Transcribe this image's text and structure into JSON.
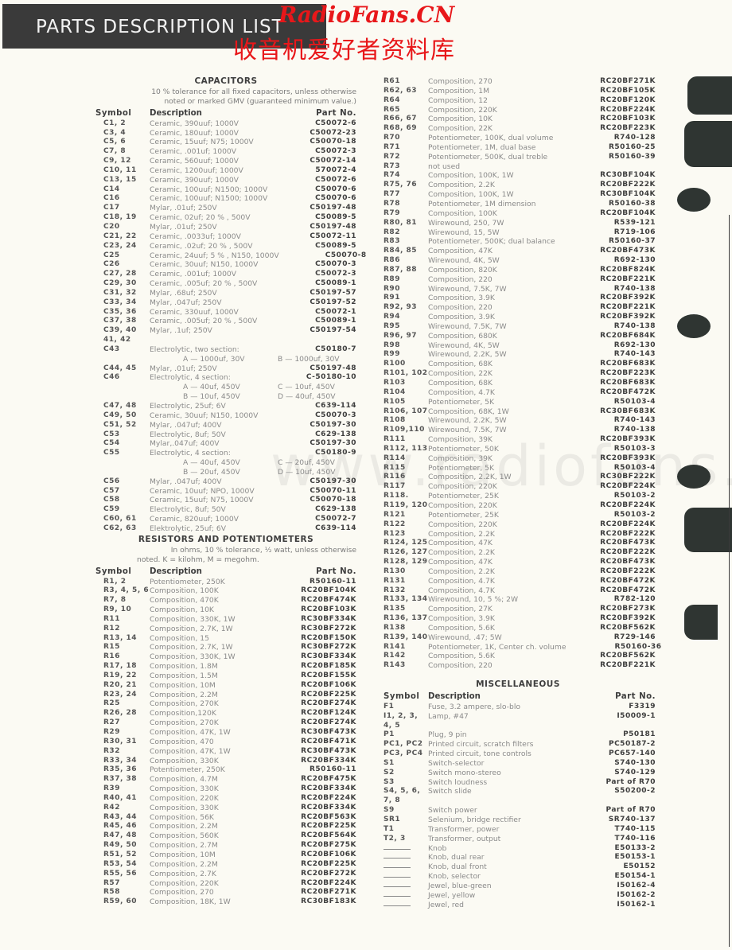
{
  "header": {
    "title": "PARTS DESCRIPTION LIST",
    "watermark_en": "RadioFans.CN",
    "watermark_cn": "收音机爱好者资料库",
    "watermark_faint": "www.radiofans.cn"
  },
  "columns": {
    "symbol": "Symbol",
    "description": "Description",
    "part_no": "Part No."
  },
  "capacitors": {
    "title": "CAPACITORS",
    "note_line1": "10 % tolerance for all fixed capacitors, unless otherwise",
    "note_line2": "noted or marked GMV (guaranteed minimum value.)",
    "rows": [
      {
        "sym": "C1, 2",
        "desc": "Ceramic, 390uuf; 1000V",
        "part": "C50072-6"
      },
      {
        "sym": "C3, 4",
        "desc": "Ceramic, 180uuf; 1000V",
        "part": "C50072-23"
      },
      {
        "sym": "C5, 6",
        "desc": "Ceramic, 15uuf; N75; 1000V",
        "part": "C50070-18"
      },
      {
        "sym": "C7, 8",
        "desc": "Ceramic, .001uf; 1000V",
        "part": "C50072-3"
      },
      {
        "sym": "C9, 12",
        "desc": "Ceramic, 560uuf; 1000V",
        "part": "C50072-14"
      },
      {
        "sym": "C10, 11",
        "desc": "Ceramic, 1200uuf; 1000V",
        "part": "570072-4"
      },
      {
        "sym": "C13, 15",
        "desc": "Ceramic, 390uuf; 1000V",
        "part": "C50072-6"
      },
      {
        "sym": "C14",
        "desc": "Ceramic, 100uuf; N1500; 1000V",
        "part": "C50070-6"
      },
      {
        "sym": "C16",
        "desc": "Ceramic, 100uuf; N1500; 1000V",
        "part": "C50070-6"
      },
      {
        "sym": "C17",
        "desc": "Mylar, .01uf; 250V",
        "part": "C50197-48"
      },
      {
        "sym": "C18, 19",
        "desc": "Ceramic, 02uf; 20 % , 500V",
        "part": "C50089-5"
      },
      {
        "sym": "C20",
        "desc": "Mylar, .01uf; 250V",
        "part": "C50197-48"
      },
      {
        "sym": "C21, 22",
        "desc": "Ceramic, .0033uf; 1000V",
        "part": "C50072-11"
      },
      {
        "sym": "C23, 24",
        "desc": "Ceramic, .02uf; 20 % , 500V",
        "part": "C50089-5"
      },
      {
        "sym": "C25",
        "desc": "Ceramic, 24uuf; 5 % , N150, 1000V",
        "part": "C50070-8"
      },
      {
        "sym": "C26",
        "desc": "Ceramic, 30uuf; N150, 1000V",
        "part": "C50070-3"
      },
      {
        "sym": "C27, 28",
        "desc": "Ceramic, .001uf; 1000V",
        "part": "C50072-3"
      },
      {
        "sym": "C29, 30",
        "desc": "Ceramic, .005uf; 20 % , 500V",
        "part": "C50089-1"
      },
      {
        "sym": "C31, 32",
        "desc": "Mylar, .68uf; 250V",
        "part": "C50197-57"
      },
      {
        "sym": "C33, 34",
        "desc": "Mylar, .047uf; 250V",
        "part": "C50197-52"
      },
      {
        "sym": "C35, 36",
        "desc": "Ceramic, 330uuf, 1000V",
        "part": "C50072-1"
      },
      {
        "sym": "C37, 38",
        "desc": "Ceramic, .005uf; 20 % , 500V",
        "part": "C50089-1"
      },
      {
        "sym": "C39, 40",
        "desc": "Mylar, .1uf; 250V",
        "part": "C50197-54"
      },
      {
        "sym": "41, 42",
        "desc": "",
        "part": ""
      },
      {
        "sym": "C43",
        "desc": "Electrolytic, two section:",
        "part": "C50180-7",
        "sub": [
          [
            "A — 1000uf, 30V",
            "B — 1000uf, 30V"
          ]
        ]
      },
      {
        "sym": "C44, 45",
        "desc": "Mylar, .01uf; 250V",
        "part": "C50197-48"
      },
      {
        "sym": "C46",
        "desc": "Electrolytic, 4 section:",
        "part": "C-50180-10",
        "sub": [
          [
            "A — 40uf, 450V",
            "C — 10uf, 450V"
          ],
          [
            "B — 10uf, 450V",
            "D — 40uf, 450V"
          ]
        ]
      },
      {
        "sym": "C47, 48",
        "desc": "Electrolytic, 25uf; 6V",
        "part": "C639-114"
      },
      {
        "sym": "C49, 50",
        "desc": "Ceramic, 30uuf; N150, 1000V",
        "part": "C50070-3"
      },
      {
        "sym": "C51, 52",
        "desc": "Mylar, .047uf; 400V",
        "part": "C50197-30"
      },
      {
        "sym": "C53",
        "desc": "Electrolytic, 8uf; 50V",
        "part": "C629-138"
      },
      {
        "sym": "C54",
        "desc": "Mylar,.047uf; 400V",
        "part": "C50197-30"
      },
      {
        "sym": "C55",
        "desc": "Electrolytic, 4 section:",
        "part": "C50180-9",
        "sub": [
          [
            "A — 40uf, 450V",
            "C — 20uf, 450V"
          ],
          [
            "B — 20uf, 450V",
            "D — 10uf, 450V"
          ]
        ]
      },
      {
        "sym": "C56",
        "desc": "Mylar, .047uf; 400V",
        "part": "C50197-30"
      },
      {
        "sym": "C57",
        "desc": "Ceramic, 10uuf; NPO, 1000V",
        "part": "C50070-11"
      },
      {
        "sym": "C58",
        "desc": "Ceramic, 15uuf; N75, 1000V",
        "part": "C50070-18"
      },
      {
        "sym": "C59",
        "desc": "Electrolytic, 8uf; 50V",
        "part": "C629-138"
      },
      {
        "sym": "C60, 61",
        "desc": "Ceramic, 820uuf; 1000V",
        "part": "C50072-7"
      },
      {
        "sym": "C62, 63",
        "desc": "Elektrolytic, 25uf; 6V",
        "part": "C639-114"
      }
    ]
  },
  "resistors": {
    "title": "RESISTORS AND POTENTIOMETERS",
    "note_line1": "In ohms, 10 % tolerance, ½ watt, unless otherwise",
    "note_line2": "noted. K = kilohm, M = megohm.",
    "rows_left": [
      {
        "sym": "R1, 2",
        "desc": "Potentiometer, 250K",
        "part": "R50160-11"
      },
      {
        "sym": "R3, 4, 5, 6",
        "desc": "Composition, 100K",
        "part": "RC20BF104K"
      },
      {
        "sym": "R7, 8",
        "desc": "Composition, 470K",
        "part": "RC20BF474K"
      },
      {
        "sym": "R9, 10",
        "desc": "Composition, 10K",
        "part": "RC20BF103K"
      },
      {
        "sym": "R11",
        "desc": "Composition, 330K, 1W",
        "part": "RC30BF334K"
      },
      {
        "sym": "R12",
        "desc": "Composition, 2.7K, 1W",
        "part": "RC30BF272K"
      },
      {
        "sym": "R13, 14",
        "desc": "Composition, 15",
        "part": "RC20BF150K"
      },
      {
        "sym": "R15",
        "desc": "Composition, 2.7K, 1W",
        "part": "RC30BF272K"
      },
      {
        "sym": "R16",
        "desc": "Composition, 330K, 1W",
        "part": "RC30BF334K"
      },
      {
        "sym": "R17, 18",
        "desc": "Composition, 1.8M",
        "part": "RC20BF185K"
      },
      {
        "sym": "R19, 22",
        "desc": "Composition, 1.5M",
        "part": "RC20BF155K"
      },
      {
        "sym": "R20, 21",
        "desc": "Composition, 10M",
        "part": "RC20BF106K"
      },
      {
        "sym": "R23, 24",
        "desc": "Composition, 2.2M",
        "part": "RC20BF225K"
      },
      {
        "sym": "R25",
        "desc": "Composition, 270K",
        "part": "RC20BF274K"
      },
      {
        "sym": "R26, 28",
        "desc": "Composition,120K",
        "part": "RC20BF124K"
      },
      {
        "sym": "R27",
        "desc": "Composition, 270K",
        "part": "RC20BF274K"
      },
      {
        "sym": "R29",
        "desc": "Composition, 47K, 1W",
        "part": "RC30BF473K"
      },
      {
        "sym": "R30, 31",
        "desc": "Composition, 470",
        "part": "RC20BF471K"
      },
      {
        "sym": "R32",
        "desc": "Composition, 47K, 1W",
        "part": "RC30BF473K"
      },
      {
        "sym": "R33, 34",
        "desc": "Composition, 330K",
        "part": "RC20BF334K"
      },
      {
        "sym": "R35, 36",
        "desc": "Potentiometer, 250K",
        "part": "R50160-11"
      },
      {
        "sym": "R37, 38",
        "desc": "Composition, 4.7M",
        "part": "RC20BF475K"
      },
      {
        "sym": "R39",
        "desc": "Composition, 330K",
        "part": "RC20BF334K"
      },
      {
        "sym": "R40, 41",
        "desc": "Composition, 220K",
        "part": "RC20BF224K"
      },
      {
        "sym": "R42",
        "desc": "Composition, 330K",
        "part": "RC20BF334K"
      },
      {
        "sym": "R43, 44",
        "desc": "Composition, 56K",
        "part": "RC20BF563K"
      },
      {
        "sym": "R45, 46",
        "desc": "Composition, 2.2M",
        "part": "RC20BF225K"
      },
      {
        "sym": "R47, 48",
        "desc": "Composition, 560K",
        "part": "RC20BF564K"
      },
      {
        "sym": "R49, 50",
        "desc": "Composition, 2.7M",
        "part": "RC20BF275K"
      },
      {
        "sym": "R51, 52",
        "desc": "Composition, 10M",
        "part": "RC20BF106K"
      },
      {
        "sym": "R53, 54",
        "desc": "Composition, 2.2M",
        "part": "RC20BF225K"
      },
      {
        "sym": "R55, 56",
        "desc": "Composition, 2.7K",
        "part": "RC20BF272K"
      },
      {
        "sym": "R57",
        "desc": "Composition, 220K",
        "part": "RC20BF224K"
      },
      {
        "sym": "R58",
        "desc": "Composition, 270",
        "part": "RC20BF271K"
      },
      {
        "sym": "R59, 60",
        "desc": "Composition, 18K, 1W",
        "part": "RC30BF183K"
      }
    ],
    "rows_right": [
      {
        "sym": "R61",
        "desc": "Composition, 270",
        "part": "RC20BF271K"
      },
      {
        "sym": "R62, 63",
        "desc": "Composition, 1M",
        "part": "RC20BF105K"
      },
      {
        "sym": "R64",
        "desc": "Composition, 12",
        "part": "RC20BF120K"
      },
      {
        "sym": "R65",
        "desc": "Composition, 220K",
        "part": "RC20BF224K"
      },
      {
        "sym": "R66, 67",
        "desc": "Composition, 10K",
        "part": "RC20BF103K"
      },
      {
        "sym": "R68, 69",
        "desc": "Composition, 22K",
        "part": "RC20BF223K"
      },
      {
        "sym": "R70",
        "desc": "Potentiometer, 100K,   dual volume",
        "part": "R740-128"
      },
      {
        "sym": "R71",
        "desc": "Potentiometer, 1M, dual base",
        "part": "R50160-25"
      },
      {
        "sym": "R72",
        "desc": "Potentiometer, 500K, dual treble",
        "part": "R50160-39"
      },
      {
        "sym": "R73",
        "desc": "not used",
        "part": ""
      },
      {
        "sym": "R74",
        "desc": "Composition, 100K, 1W",
        "part": "RC30BF104K"
      },
      {
        "sym": "R75, 76",
        "desc": "Composition, 2.2K",
        "part": "RC20BF222K"
      },
      {
        "sym": "R77",
        "desc": "Composition, 100K, 1W",
        "part": "RC30BF104K"
      },
      {
        "sym": "R78",
        "desc": "Potentiometer, 1M dimension",
        "part": "R50160-38"
      },
      {
        "sym": "R79",
        "desc": "Composition, 100K",
        "part": "RC20BF104K"
      },
      {
        "sym": "R80, 81",
        "desc": "Wirewound, 250, 7W",
        "part": "R539-121"
      },
      {
        "sym": "R82",
        "desc": "Wirewound, 15, 5W",
        "part": "R719-106"
      },
      {
        "sym": "R83",
        "desc": "Potentiometer, 500K;   dual balance",
        "part": "R50160-37"
      },
      {
        "sym": "R84, 85",
        "desc": "Composition, 47K",
        "part": "RC20BF473K"
      },
      {
        "sym": "R86",
        "desc": "Wirewound, 4K, 5W",
        "part": "R692-130"
      },
      {
        "sym": "R87, 88",
        "desc": "Composition, 820K",
        "part": "RC20BF824K"
      },
      {
        "sym": "R89",
        "desc": "Composition, 220",
        "part": "RC20BF221K"
      },
      {
        "sym": "R90",
        "desc": "Wirewound, 7.5K, 7W",
        "part": "R740-138"
      },
      {
        "sym": "R91",
        "desc": "Composition, 3.9K",
        "part": "RC20BF392K"
      },
      {
        "sym": "R92, 93",
        "desc": "Composition, 220",
        "part": "RC20BF221K"
      },
      {
        "sym": "R94",
        "desc": "Composition, 3.9K",
        "part": "RC20BF392K"
      },
      {
        "sym": "R95",
        "desc": "Wirewound, 7.5K, 7W",
        "part": "R740-138"
      },
      {
        "sym": "R96, 97",
        "desc": "Composition, 680K",
        "part": "RC20BF684K"
      },
      {
        "sym": "R98",
        "desc": "Wirewound, 4K, 5W",
        "part": "R692-130"
      },
      {
        "sym": "R99",
        "desc": "Wirewound, 2.2K, 5W",
        "part": "R740-143"
      },
      {
        "sym": "R100",
        "desc": "Composition, 68K",
        "part": "RC20BF683K"
      },
      {
        "sym": "R101, 102",
        "desc": "Composition, 22K",
        "part": "RC20BF223K"
      },
      {
        "sym": "R103",
        "desc": "Composition, 68K",
        "part": "RC20BF683K"
      },
      {
        "sym": "R104",
        "desc": "Composition, 4.7K",
        "part": "RC20BF472K"
      },
      {
        "sym": "R105",
        "desc": "Potentiometer, 5K",
        "part": "R50103-4"
      },
      {
        "sym": "R106, 107",
        "desc": "Composition, 68K, 1W",
        "part": "RC30BF683K"
      },
      {
        "sym": "R108",
        "desc": "Wirewound, 2.2K, 5W",
        "part": "R740-143"
      },
      {
        "sym": "R109,110",
        "desc": "Wirewound, 7.5K, 7W",
        "part": "R740-138"
      },
      {
        "sym": "R111",
        "desc": "Composition, 39K",
        "part": "RC20BF393K"
      },
      {
        "sym": "R112, 113",
        "desc": "Potentiometer, 50K",
        "part": "R50103-3"
      },
      {
        "sym": "R114",
        "desc": "Composition, 39K",
        "part": "RC20BF393K"
      },
      {
        "sym": "R115",
        "desc": "Potentiometer, 5K",
        "part": "R50103-4"
      },
      {
        "sym": "R116",
        "desc": "Composition, 2.2K, 1W",
        "part": "RC30BF222K"
      },
      {
        "sym": "R117",
        "desc": "Composition, 220K",
        "part": "RC20BF224K"
      },
      {
        "sym": "R118.",
        "desc": "Potentiometer, 25K",
        "part": "R50103-2"
      },
      {
        "sym": "R119, 120",
        "desc": "Composition, 220K",
        "part": "RC20BF224K"
      },
      {
        "sym": "R121",
        "desc": "Potentiometer, 25K",
        "part": "R50103-2"
      },
      {
        "sym": "R122",
        "desc": "Composition, 220K",
        "part": "RC20BF224K"
      },
      {
        "sym": "R123",
        "desc": "Composition, 2.2K",
        "part": "RC20BF222K"
      },
      {
        "sym": "R124, 125",
        "desc": "Composition, 47K",
        "part": "RC20BF473K"
      },
      {
        "sym": "R126, 127",
        "desc": "Composition, 2.2K",
        "part": "RC20BF222K"
      },
      {
        "sym": "R128, 129",
        "desc": "Composition, 47K",
        "part": "RC20BF473K"
      },
      {
        "sym": "R130",
        "desc": "Composition, 2.2K",
        "part": "RC20BF222K"
      },
      {
        "sym": "R131",
        "desc": "Composition, 4.7K",
        "part": "RC20BF472K"
      },
      {
        "sym": "R132",
        "desc": "Composition, 4.7K",
        "part": "RC20BF472K"
      },
      {
        "sym": "R133, 134",
        "desc": "Wirewound, 10, 5 %; 2W",
        "part": "R782-120"
      },
      {
        "sym": "R135",
        "desc": "Composition, 27K",
        "part": "RC20BF273K"
      },
      {
        "sym": "R136, 137",
        "desc": "Composition, 3.9K",
        "part": "RC20BF392K"
      },
      {
        "sym": "R138",
        "desc": "Composition, 5.6K",
        "part": "RC20BF562K"
      },
      {
        "sym": "R139, 140",
        "desc": "Wirewound, .47; 5W",
        "part": "R729-146"
      },
      {
        "sym": "R141",
        "desc": "Potentiometer, 1K,   Center ch. volume",
        "part": "R50160-36"
      },
      {
        "sym": "R142",
        "desc": "Composition, 5.6K",
        "part": "RC20BF562K"
      },
      {
        "sym": "R143",
        "desc": "Composition, 220",
        "part": "RC20BF221K"
      }
    ]
  },
  "miscellaneous": {
    "title": "MISCELLANEOUS",
    "rows": [
      {
        "sym": "F1",
        "desc": "Fuse, 3.2 ampere, slo-blo",
        "part": "F3319"
      },
      {
        "sym": "I1, 2, 3,",
        "desc": "Lamp, #47",
        "part": "I50009-1"
      },
      {
        "sym": "4, 5",
        "desc": "",
        "part": ""
      },
      {
        "sym": "P1",
        "desc": "Plug, 9 pin",
        "part": "P50181"
      },
      {
        "sym": "PC1, PC2",
        "desc": "Printed circuit, scratch filters",
        "part": "PC50187-2"
      },
      {
        "sym": "PC3, PC4",
        "desc": "Printed circuit, tone controls",
        "part": "PC657-140"
      },
      {
        "sym": "S1",
        "desc": "Switch-selector",
        "part": "S740-130"
      },
      {
        "sym": "S2",
        "desc": "Switch mono-stereo",
        "part": "S740-129"
      },
      {
        "sym": "S3",
        "desc": "Switch loudness",
        "part": "Part of R70"
      },
      {
        "sym": "S4, 5, 6,",
        "desc": "Switch slide",
        "part": "S50200-2"
      },
      {
        "sym": "7, 8",
        "desc": "",
        "part": ""
      },
      {
        "sym": "S9",
        "desc": "Switch power",
        "part": "Part of R70"
      },
      {
        "sym": "SR1",
        "desc": "Selenium, bridge rectifier",
        "part": "SR740-137"
      },
      {
        "sym": "T1",
        "desc": "Transformer, power",
        "part": "T740-115"
      },
      {
        "sym": "T2, 3",
        "desc": "Transformer, output",
        "part": "T740-116"
      },
      {
        "sym": "—",
        "desc": "Knob",
        "part": "E50133-2"
      },
      {
        "sym": "—",
        "desc": "Knob, dual rear",
        "part": "E50153-1"
      },
      {
        "sym": "—",
        "desc": "Knob, dual front",
        "part": "E50152"
      },
      {
        "sym": "—",
        "desc": "Knob, selector",
        "part": "E50154-1"
      },
      {
        "sym": "—",
        "desc": "Jewel, blue-green",
        "part": "I50162-4"
      },
      {
        "sym": "—",
        "desc": "Jewel, yellow",
        "part": "I50162-2"
      },
      {
        "sym": "—",
        "desc": "Jewel, red",
        "part": "I50162-1"
      }
    ]
  }
}
